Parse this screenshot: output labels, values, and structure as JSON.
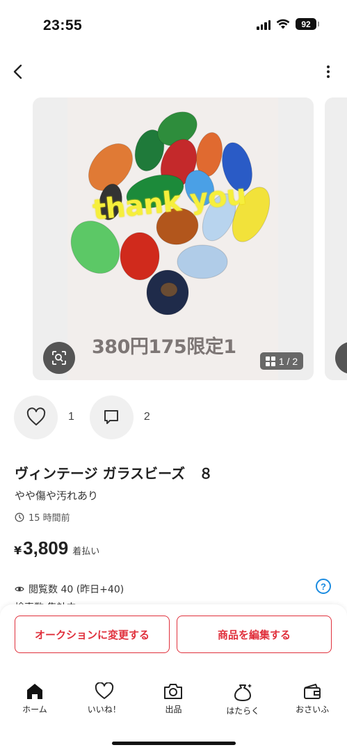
{
  "status_bar": {
    "time": "23:55",
    "battery": "92"
  },
  "carousel": {
    "overlay_text": "thank you",
    "price_caption": "380円175限定1",
    "page_indicator": "1 / 2"
  },
  "actions": {
    "like_count": "1",
    "comment_count": "2"
  },
  "item": {
    "title": "ヴィンテージ ガラスビーズ　８",
    "condition": "やや傷や汚れあり",
    "listed_time": "15 時間前",
    "price_symbol": "¥",
    "price": "3,809",
    "shipping": "着払い",
    "views": "閲覧数 40 (昨日+40)",
    "partial_row": "検索数 集計中"
  },
  "buttons": {
    "auction": "オークションに変更する",
    "edit": "商品を編集する"
  },
  "tabs": [
    {
      "label": "ホーム",
      "icon": "home-icon"
    },
    {
      "label": "いいね！",
      "icon": "heart-icon"
    },
    {
      "label": "出品",
      "icon": "camera-icon"
    },
    {
      "label": "はたらく",
      "icon": "bag-icon"
    },
    {
      "label": "おさいふ",
      "icon": "wallet-icon"
    }
  ],
  "colors": {
    "accent": "#e0303c",
    "help": "#1a8be0"
  }
}
